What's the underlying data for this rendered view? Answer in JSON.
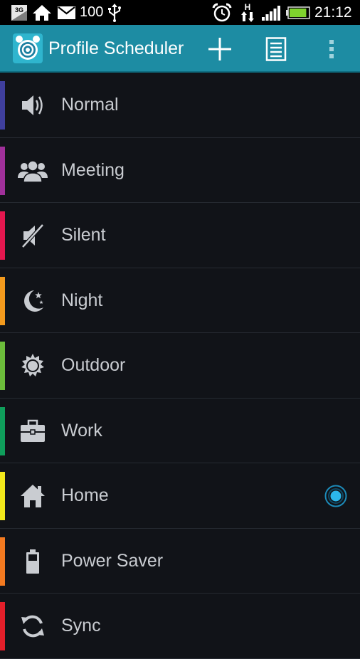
{
  "status_bar": {
    "network_badge": "3G",
    "battery_level_text": "100",
    "time": "21:12",
    "signal_label": "H",
    "battery_fill": 0.9,
    "icons": [
      "3g-icon",
      "home-icon",
      "mail-icon",
      "usb-icon",
      "alarm-icon",
      "data-arrows-icon",
      "signal-icon",
      "battery-icon"
    ]
  },
  "action_bar": {
    "title": "Profile Scheduler",
    "actions": [
      "add-icon",
      "document-list-icon",
      "overflow-menu-icon"
    ],
    "background_color": "#1d8ca3"
  },
  "profiles": [
    {
      "label": "Normal",
      "icon": "volume-icon",
      "color": "#3f3f9d",
      "active": false
    },
    {
      "label": "Meeting",
      "icon": "people-icon",
      "color": "#a0309a",
      "active": false
    },
    {
      "label": "Silent",
      "icon": "muted-icon",
      "color": "#e5174f",
      "active": false
    },
    {
      "label": "Night",
      "icon": "moon-icon",
      "color": "#f39a1d",
      "active": false
    },
    {
      "label": "Outdoor",
      "icon": "sun-icon",
      "color": "#6cbd3b",
      "active": false
    },
    {
      "label": "Work",
      "icon": "briefcase-icon",
      "color": "#0f9e5b",
      "active": false
    },
    {
      "label": "Home",
      "icon": "house-icon",
      "color": "#f2e81b",
      "active": true
    },
    {
      "label": "Power Saver",
      "icon": "battery-icon",
      "color": "#f47a20",
      "active": false
    },
    {
      "label": "Sync",
      "icon": "sync-icon",
      "color": "#e41f2a",
      "active": false
    }
  ]
}
